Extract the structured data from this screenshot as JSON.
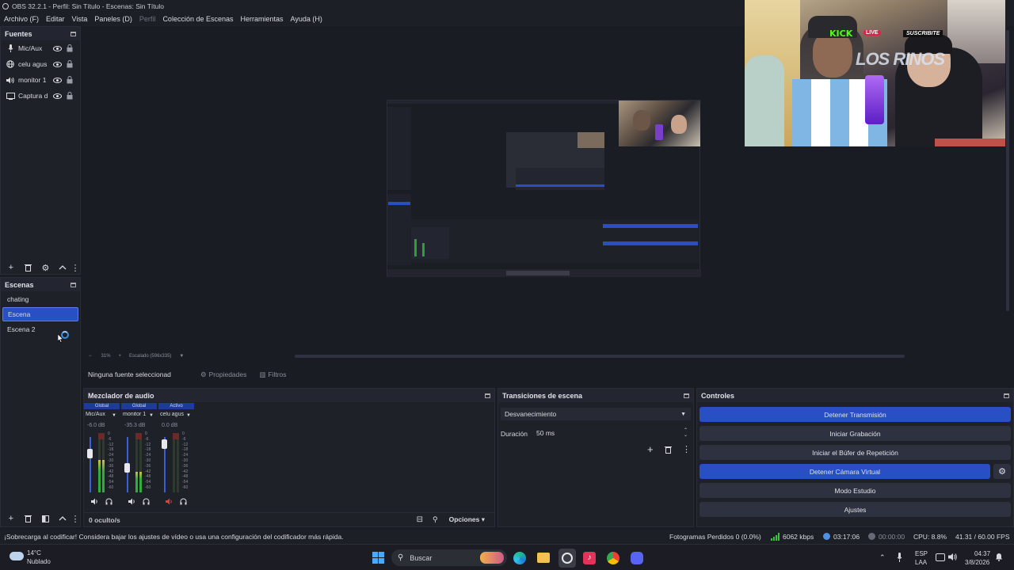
{
  "window": {
    "title": "OBS 32.2.1 - Perfil: Sin Título - Escenas: Sin Título"
  },
  "menu": [
    {
      "label": "Archivo (F)",
      "enabled": true
    },
    {
      "label": "Editar",
      "enabled": true
    },
    {
      "label": "Vista",
      "enabled": true
    },
    {
      "label": "Paneles (D)",
      "enabled": true
    },
    {
      "label": "Perfil",
      "enabled": false
    },
    {
      "label": "Colección de Escenas",
      "enabled": true
    },
    {
      "label": "Herramientas",
      "enabled": true
    },
    {
      "label": "Ayuda (H)",
      "enabled": true
    }
  ],
  "sources": {
    "title": "Fuentes",
    "items": [
      {
        "label": "Mic/Aux",
        "icon": "microphone-icon"
      },
      {
        "label": "celu agus",
        "icon": "globe-icon"
      },
      {
        "label": "monitor 1",
        "icon": "speaker-icon"
      },
      {
        "label": "Captura d",
        "icon": "monitor-icon"
      }
    ]
  },
  "scenes": {
    "title": "Escenas",
    "items": [
      {
        "label": "chating",
        "selected": false
      },
      {
        "label": "Escena",
        "selected": true
      },
      {
        "label": "Escena 2",
        "selected": false
      }
    ]
  },
  "preview": {
    "zoom": "31%",
    "scale_label": "Escalado (596x335)"
  },
  "webcam": {
    "brand": "KICK",
    "live": "LIVE",
    "subscribe": "SUSCRIBITE",
    "logo_text": "LOS RINOS"
  },
  "source_bar": {
    "no_source": "Ninguna fuente seleccionad",
    "properties": "Propiedades",
    "filters": "Filtros"
  },
  "mixer": {
    "title": "Mezclador de audio",
    "channels": [
      {
        "tag": "Global",
        "name": "Mic/Aux",
        "db": "-6.0 dB",
        "level": 0.55,
        "muted": false
      },
      {
        "tag": "Global",
        "name": "monitor 1",
        "db": "-35.3 dB",
        "level": 0.35,
        "muted": false
      },
      {
        "tag": "Activo",
        "name": "celu agus",
        "db": "0.0 dB",
        "level": 0.0,
        "muted": true
      }
    ],
    "scale": [
      "0",
      "-6",
      "-12",
      "-18",
      "-24",
      "-30",
      "-36",
      "-42",
      "-48",
      "-54",
      "-60"
    ],
    "hidden": "0 oculto/s",
    "options": "Opciones"
  },
  "transitions": {
    "title": "Transiciones de escena",
    "selected": "Desvanecimiento",
    "duration_label": "Duración",
    "duration_value": "50 ms"
  },
  "controls": {
    "title": "Controles",
    "buttons": [
      {
        "label": "Detener Transmisión",
        "active": true
      },
      {
        "label": "Iniciar Grabación",
        "active": false
      },
      {
        "label": "Iniciar el Búfer de Repetición",
        "active": false
      },
      {
        "label": "Detener Cámara Virtual",
        "active": true
      },
      {
        "label": "Modo Estudio",
        "active": false
      },
      {
        "label": "Ajustes",
        "active": false
      }
    ]
  },
  "status": {
    "warning": "¡Sobrecarga al codificar! Considera bajar los ajustes de vídeo o usa una configuración del codificador más rápida.",
    "dropped": "Fotogramas Perdidos 0 (0.0%)",
    "bitrate": "6062 kbps",
    "stream_time": "03:17:06",
    "rec_time": "00:00:00",
    "cpu": "CPU: 8.8%",
    "fps": "41.31 / 60.00 FPS"
  },
  "taskbar": {
    "temp": "14°C",
    "weather": "Nublado",
    "search": "Buscar",
    "lang1": "ESP",
    "lang2": "LAA",
    "time": "04:37",
    "date": "3/8/2026"
  },
  "colors": {
    "accent": "#284fc4",
    "bg": "#1a1c23",
    "panel": "#1f2129"
  }
}
